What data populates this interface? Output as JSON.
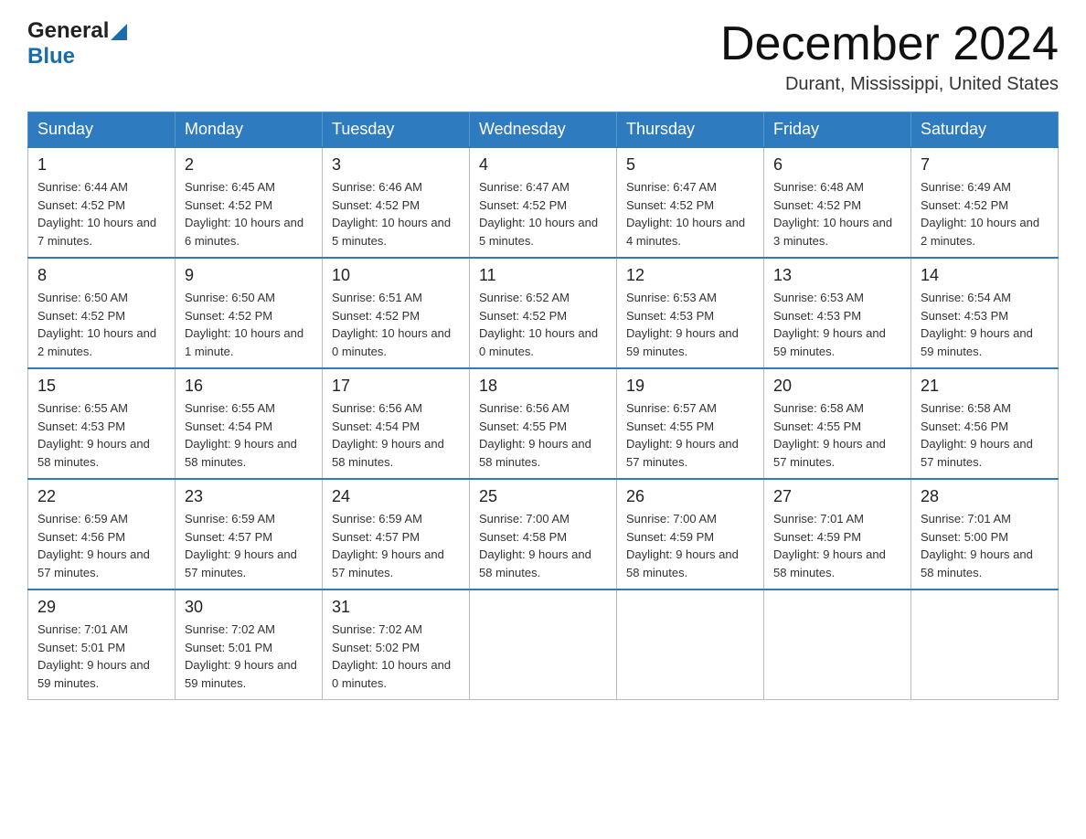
{
  "header": {
    "logo_line1": "General",
    "logo_line2": "Blue",
    "month_title": "December 2024",
    "location": "Durant, Mississippi, United States"
  },
  "weekdays": [
    "Sunday",
    "Monday",
    "Tuesday",
    "Wednesday",
    "Thursday",
    "Friday",
    "Saturday"
  ],
  "weeks": [
    [
      {
        "day": "1",
        "sunrise": "6:44 AM",
        "sunset": "4:52 PM",
        "daylight": "10 hours and 7 minutes."
      },
      {
        "day": "2",
        "sunrise": "6:45 AM",
        "sunset": "4:52 PM",
        "daylight": "10 hours and 6 minutes."
      },
      {
        "day": "3",
        "sunrise": "6:46 AM",
        "sunset": "4:52 PM",
        "daylight": "10 hours and 5 minutes."
      },
      {
        "day": "4",
        "sunrise": "6:47 AM",
        "sunset": "4:52 PM",
        "daylight": "10 hours and 5 minutes."
      },
      {
        "day": "5",
        "sunrise": "6:47 AM",
        "sunset": "4:52 PM",
        "daylight": "10 hours and 4 minutes."
      },
      {
        "day": "6",
        "sunrise": "6:48 AM",
        "sunset": "4:52 PM",
        "daylight": "10 hours and 3 minutes."
      },
      {
        "day": "7",
        "sunrise": "6:49 AM",
        "sunset": "4:52 PM",
        "daylight": "10 hours and 2 minutes."
      }
    ],
    [
      {
        "day": "8",
        "sunrise": "6:50 AM",
        "sunset": "4:52 PM",
        "daylight": "10 hours and 2 minutes."
      },
      {
        "day": "9",
        "sunrise": "6:50 AM",
        "sunset": "4:52 PM",
        "daylight": "10 hours and 1 minute."
      },
      {
        "day": "10",
        "sunrise": "6:51 AM",
        "sunset": "4:52 PM",
        "daylight": "10 hours and 0 minutes."
      },
      {
        "day": "11",
        "sunrise": "6:52 AM",
        "sunset": "4:52 PM",
        "daylight": "10 hours and 0 minutes."
      },
      {
        "day": "12",
        "sunrise": "6:53 AM",
        "sunset": "4:53 PM",
        "daylight": "9 hours and 59 minutes."
      },
      {
        "day": "13",
        "sunrise": "6:53 AM",
        "sunset": "4:53 PM",
        "daylight": "9 hours and 59 minutes."
      },
      {
        "day": "14",
        "sunrise": "6:54 AM",
        "sunset": "4:53 PM",
        "daylight": "9 hours and 59 minutes."
      }
    ],
    [
      {
        "day": "15",
        "sunrise": "6:55 AM",
        "sunset": "4:53 PM",
        "daylight": "9 hours and 58 minutes."
      },
      {
        "day": "16",
        "sunrise": "6:55 AM",
        "sunset": "4:54 PM",
        "daylight": "9 hours and 58 minutes."
      },
      {
        "day": "17",
        "sunrise": "6:56 AM",
        "sunset": "4:54 PM",
        "daylight": "9 hours and 58 minutes."
      },
      {
        "day": "18",
        "sunrise": "6:56 AM",
        "sunset": "4:55 PM",
        "daylight": "9 hours and 58 minutes."
      },
      {
        "day": "19",
        "sunrise": "6:57 AM",
        "sunset": "4:55 PM",
        "daylight": "9 hours and 57 minutes."
      },
      {
        "day": "20",
        "sunrise": "6:58 AM",
        "sunset": "4:55 PM",
        "daylight": "9 hours and 57 minutes."
      },
      {
        "day": "21",
        "sunrise": "6:58 AM",
        "sunset": "4:56 PM",
        "daylight": "9 hours and 57 minutes."
      }
    ],
    [
      {
        "day": "22",
        "sunrise": "6:59 AM",
        "sunset": "4:56 PM",
        "daylight": "9 hours and 57 minutes."
      },
      {
        "day": "23",
        "sunrise": "6:59 AM",
        "sunset": "4:57 PM",
        "daylight": "9 hours and 57 minutes."
      },
      {
        "day": "24",
        "sunrise": "6:59 AM",
        "sunset": "4:57 PM",
        "daylight": "9 hours and 57 minutes."
      },
      {
        "day": "25",
        "sunrise": "7:00 AM",
        "sunset": "4:58 PM",
        "daylight": "9 hours and 58 minutes."
      },
      {
        "day": "26",
        "sunrise": "7:00 AM",
        "sunset": "4:59 PM",
        "daylight": "9 hours and 58 minutes."
      },
      {
        "day": "27",
        "sunrise": "7:01 AM",
        "sunset": "4:59 PM",
        "daylight": "9 hours and 58 minutes."
      },
      {
        "day": "28",
        "sunrise": "7:01 AM",
        "sunset": "5:00 PM",
        "daylight": "9 hours and 58 minutes."
      }
    ],
    [
      {
        "day": "29",
        "sunrise": "7:01 AM",
        "sunset": "5:01 PM",
        "daylight": "9 hours and 59 minutes."
      },
      {
        "day": "30",
        "sunrise": "7:02 AM",
        "sunset": "5:01 PM",
        "daylight": "9 hours and 59 minutes."
      },
      {
        "day": "31",
        "sunrise": "7:02 AM",
        "sunset": "5:02 PM",
        "daylight": "10 hours and 0 minutes."
      },
      null,
      null,
      null,
      null
    ]
  ]
}
